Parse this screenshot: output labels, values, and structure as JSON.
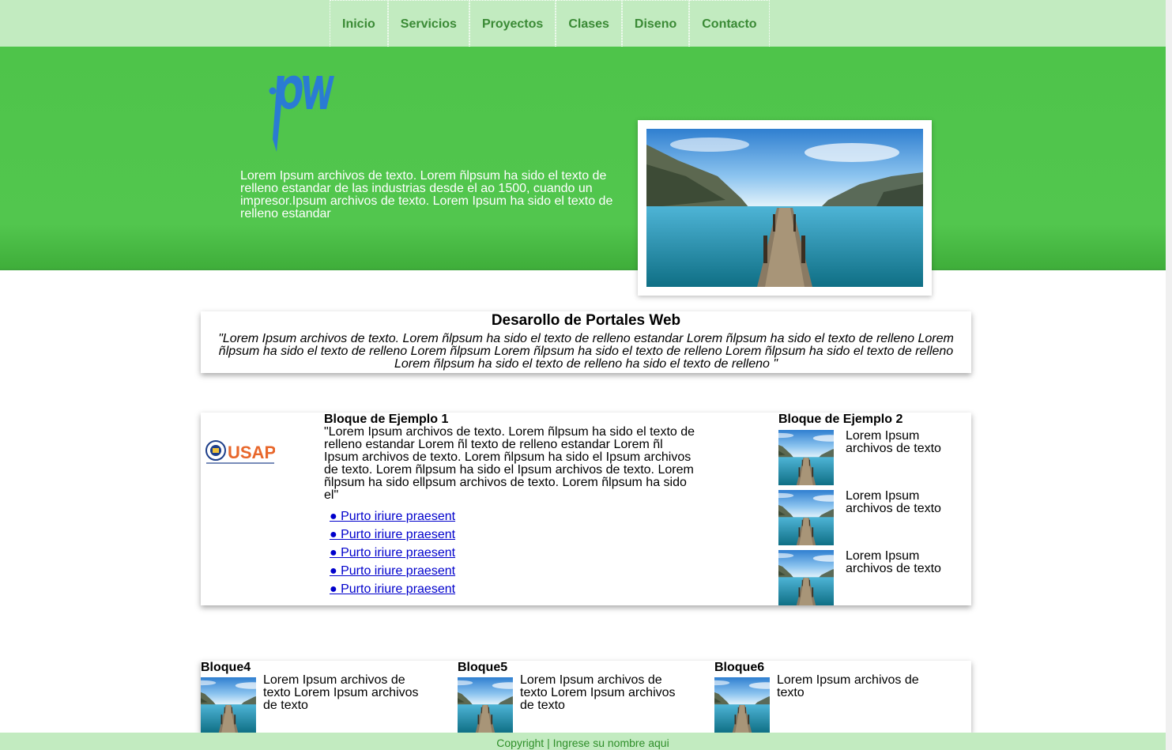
{
  "nav": {
    "items": [
      "Inicio",
      "Servicios",
      "Proyectos",
      "Clases",
      "Diseno",
      "Contacto"
    ]
  },
  "hero": {
    "logo_text": ".pw",
    "text": "Lorem Ipsum archivos de texto. Lorem ñlpsum ha sido el texto de relleno estandar de las industrias desde el ao 1500, cuando un impresor.Ipsum archivos de texto. Lorem Ipsum ha sido el texto de relleno estandar"
  },
  "intro": {
    "title": "Desarollo de Portales Web",
    "text": "\"Lorem Ipsum archivos de texto. Lorem ñlpsum ha sido el texto de relleno estandar Lorem ñlpsum ha sido el texto de relleno Lorem ñlpsum ha sido el texto de relleno Lorem ñlpsum Lorem ñlpsum ha sido el texto de relleno Lorem ñlpsum ha sido el texto de relleno Lorem ñlpsum ha sido el texto de relleno ha sido el texto de relleno \""
  },
  "usap_logo_text": "USAP",
  "block1": {
    "title": "Bloque de Ejemplo 1",
    "text": "\"Lorem Ipsum archivos de texto. Lorem ñlpsum ha sido el texto de relleno estandar Lorem ñl texto de relleno estandar Lorem ñl Ipsum archivos de texto. Lorem ñlpsum ha sido el Ipsum archivos de texto. Lorem ñlpsum ha sido el Ipsum archivos de texto. Lorem ñlpsum ha sido ellpsum archivos de texto. Lorem ñlpsum ha sido el\"",
    "links": [
      "● Purto iriure praesent",
      "● Purto iriure praesent",
      "● Purto iriure praesent",
      "● Purto iriure praesent",
      "● Purto iriure praesent"
    ]
  },
  "block2": {
    "title": "Bloque de Ejemplo 2",
    "items": [
      "Lorem Ipsum archivos de texto",
      "Lorem Ipsum archivos de texto",
      "Lorem Ipsum archivos de texto"
    ]
  },
  "bottom": [
    {
      "title": "Bloque4",
      "text": "Lorem Ipsum archivos de texto Lorem Ipsum archivos de texto"
    },
    {
      "title": "Bloque5",
      "text": "Lorem Ipsum archivos de texto Lorem Ipsum archivos de texto"
    },
    {
      "title": "Bloque6",
      "text": "Lorem Ipsum archivos de texto"
    }
  ],
  "footer": {
    "text": "Copyright | Ingrese su nombre aqui"
  },
  "colors": {
    "nav_bg": "#c2ebc0",
    "hero_green": "#52c64e",
    "nav_text": "#3a8a35",
    "logo_blue": "#2a7bd4",
    "link": "#0000cc"
  }
}
